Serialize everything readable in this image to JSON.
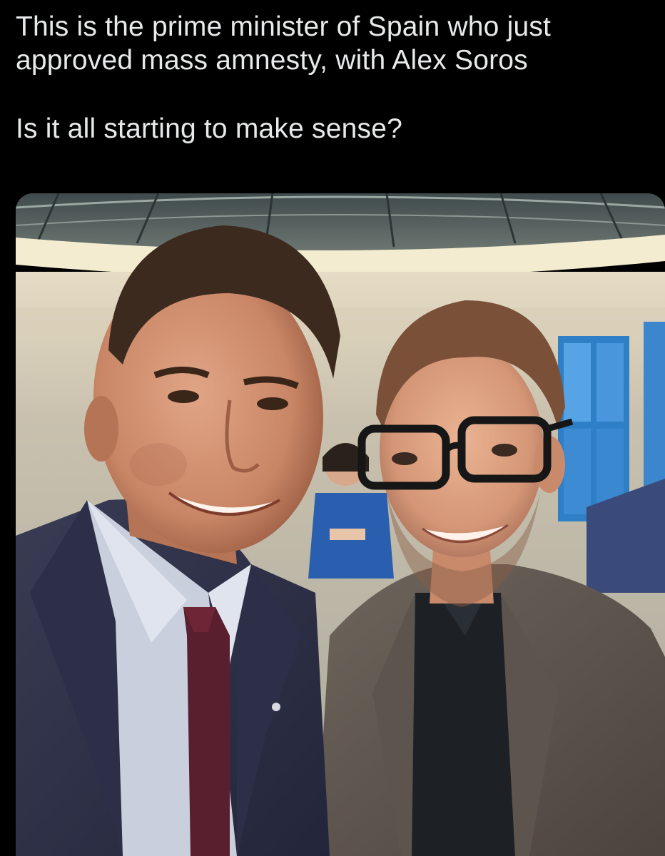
{
  "post": {
    "text_lines": [
      "This is the prime minister of Spain who just",
      "approved mass amnesty, with Alex Soros",
      "Is it all starting to make sense?"
    ]
  },
  "media": {
    "type": "photo",
    "icon": "photo-image"
  },
  "colors": {
    "background": "#000000",
    "text": "#e7e9ea"
  }
}
